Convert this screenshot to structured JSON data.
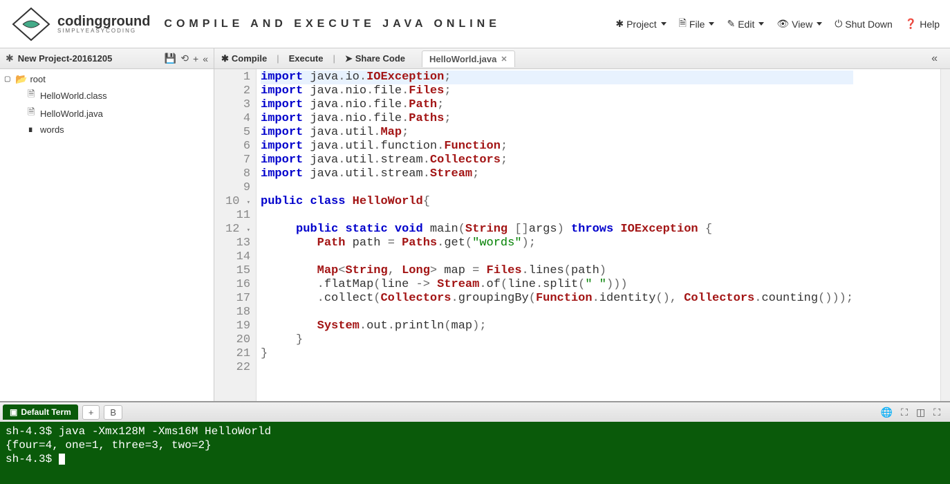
{
  "header": {
    "logo_main": "codingground",
    "logo_sub": "SIMPLYEASYCODING",
    "title": "COMPILE AND EXECUTE JAVA ONLINE",
    "menu": {
      "project": "Project",
      "file": "File",
      "edit": "Edit",
      "view": "View",
      "shutdown": "Shut Down",
      "help": "Help"
    }
  },
  "sidebar": {
    "project_name": "New Project-20161205",
    "tree": {
      "root": "root",
      "items": [
        "HelloWorld.class",
        "HelloWorld.java",
        "words"
      ]
    }
  },
  "editor_toolbar": {
    "compile": "Compile",
    "execute": "Execute",
    "share": "Share Code",
    "tab": "HelloWorld.java"
  },
  "code": {
    "lines": [
      {
        "n": 1,
        "t": [
          [
            "kw",
            "import"
          ],
          [
            "id",
            " java"
          ],
          [
            "punct",
            "."
          ],
          [
            "id",
            "io"
          ],
          [
            "punct",
            "."
          ],
          [
            "type",
            "IOException"
          ],
          [
            "punct",
            ";"
          ]
        ]
      },
      {
        "n": 2,
        "t": [
          [
            "kw",
            "import"
          ],
          [
            "id",
            " java"
          ],
          [
            "punct",
            "."
          ],
          [
            "id",
            "nio"
          ],
          [
            "punct",
            "."
          ],
          [
            "id",
            "file"
          ],
          [
            "punct",
            "."
          ],
          [
            "type",
            "Files"
          ],
          [
            "punct",
            ";"
          ]
        ]
      },
      {
        "n": 3,
        "t": [
          [
            "kw",
            "import"
          ],
          [
            "id",
            " java"
          ],
          [
            "punct",
            "."
          ],
          [
            "id",
            "nio"
          ],
          [
            "punct",
            "."
          ],
          [
            "id",
            "file"
          ],
          [
            "punct",
            "."
          ],
          [
            "type",
            "Path"
          ],
          [
            "punct",
            ";"
          ]
        ]
      },
      {
        "n": 4,
        "t": [
          [
            "kw",
            "import"
          ],
          [
            "id",
            " java"
          ],
          [
            "punct",
            "."
          ],
          [
            "id",
            "nio"
          ],
          [
            "punct",
            "."
          ],
          [
            "id",
            "file"
          ],
          [
            "punct",
            "."
          ],
          [
            "type",
            "Paths"
          ],
          [
            "punct",
            ";"
          ]
        ]
      },
      {
        "n": 5,
        "t": [
          [
            "kw",
            "import"
          ],
          [
            "id",
            " java"
          ],
          [
            "punct",
            "."
          ],
          [
            "id",
            "util"
          ],
          [
            "punct",
            "."
          ],
          [
            "type",
            "Map"
          ],
          [
            "punct",
            ";"
          ]
        ]
      },
      {
        "n": 6,
        "t": [
          [
            "kw",
            "import"
          ],
          [
            "id",
            " java"
          ],
          [
            "punct",
            "."
          ],
          [
            "id",
            "util"
          ],
          [
            "punct",
            "."
          ],
          [
            "id",
            "function"
          ],
          [
            "punct",
            "."
          ],
          [
            "type",
            "Function"
          ],
          [
            "punct",
            ";"
          ]
        ]
      },
      {
        "n": 7,
        "t": [
          [
            "kw",
            "import"
          ],
          [
            "id",
            " java"
          ],
          [
            "punct",
            "."
          ],
          [
            "id",
            "util"
          ],
          [
            "punct",
            "."
          ],
          [
            "id",
            "stream"
          ],
          [
            "punct",
            "."
          ],
          [
            "type",
            "Collectors"
          ],
          [
            "punct",
            ";"
          ]
        ]
      },
      {
        "n": 8,
        "t": [
          [
            "kw",
            "import"
          ],
          [
            "id",
            " java"
          ],
          [
            "punct",
            "."
          ],
          [
            "id",
            "util"
          ],
          [
            "punct",
            "."
          ],
          [
            "id",
            "stream"
          ],
          [
            "punct",
            "."
          ],
          [
            "type",
            "Stream"
          ],
          [
            "punct",
            ";"
          ]
        ]
      },
      {
        "n": 9,
        "t": []
      },
      {
        "n": 10,
        "fold": true,
        "t": [
          [
            "kw",
            "public"
          ],
          [
            "id",
            " "
          ],
          [
            "kw",
            "class"
          ],
          [
            "id",
            " "
          ],
          [
            "type",
            "HelloWorld"
          ],
          [
            "punct",
            "{"
          ]
        ]
      },
      {
        "n": 11,
        "t": []
      },
      {
        "n": 12,
        "fold": true,
        "t": [
          [
            "id",
            "     "
          ],
          [
            "kw",
            "public"
          ],
          [
            "id",
            " "
          ],
          [
            "kw",
            "static"
          ],
          [
            "id",
            " "
          ],
          [
            "kw",
            "void"
          ],
          [
            "id",
            " main"
          ],
          [
            "punct",
            "("
          ],
          [
            "type",
            "String"
          ],
          [
            "id",
            " "
          ],
          [
            "punct",
            "[]"
          ],
          [
            "id",
            "args"
          ],
          [
            "punct",
            ")"
          ],
          [
            "id",
            " "
          ],
          [
            "kw",
            "throws"
          ],
          [
            "id",
            " "
          ],
          [
            "type",
            "IOException"
          ],
          [
            "id",
            " "
          ],
          [
            "punct",
            "{"
          ]
        ]
      },
      {
        "n": 13,
        "t": [
          [
            "id",
            "        "
          ],
          [
            "type",
            "Path"
          ],
          [
            "id",
            " path "
          ],
          [
            "punct",
            "="
          ],
          [
            "id",
            " "
          ],
          [
            "type",
            "Paths"
          ],
          [
            "punct",
            "."
          ],
          [
            "id",
            "get"
          ],
          [
            "punct",
            "("
          ],
          [
            "str",
            "\"words\""
          ],
          [
            "punct",
            ")"
          ],
          [
            "punct",
            ";"
          ]
        ]
      },
      {
        "n": 14,
        "t": []
      },
      {
        "n": 15,
        "t": [
          [
            "id",
            "        "
          ],
          [
            "type",
            "Map"
          ],
          [
            "punct",
            "<"
          ],
          [
            "type",
            "String"
          ],
          [
            "punct",
            ","
          ],
          [
            "id",
            " "
          ],
          [
            "type",
            "Long"
          ],
          [
            "punct",
            ">"
          ],
          [
            "id",
            " map "
          ],
          [
            "punct",
            "="
          ],
          [
            "id",
            " "
          ],
          [
            "type",
            "Files"
          ],
          [
            "punct",
            "."
          ],
          [
            "id",
            "lines"
          ],
          [
            "punct",
            "("
          ],
          [
            "id",
            "path"
          ],
          [
            "punct",
            ")"
          ]
        ]
      },
      {
        "n": 16,
        "t": [
          [
            "id",
            "        "
          ],
          [
            "punct",
            "."
          ],
          [
            "id",
            "flatMap"
          ],
          [
            "punct",
            "("
          ],
          [
            "id",
            "line "
          ],
          [
            "punct",
            "->"
          ],
          [
            "id",
            " "
          ],
          [
            "type",
            "Stream"
          ],
          [
            "punct",
            "."
          ],
          [
            "id",
            "of"
          ],
          [
            "punct",
            "("
          ],
          [
            "id",
            "line"
          ],
          [
            "punct",
            "."
          ],
          [
            "id",
            "split"
          ],
          [
            "punct",
            "("
          ],
          [
            "str",
            "\" \""
          ],
          [
            "punct",
            ")))"
          ]
        ]
      },
      {
        "n": 17,
        "t": [
          [
            "id",
            "        "
          ],
          [
            "punct",
            "."
          ],
          [
            "id",
            "collect"
          ],
          [
            "punct",
            "("
          ],
          [
            "type",
            "Collectors"
          ],
          [
            "punct",
            "."
          ],
          [
            "id",
            "groupingBy"
          ],
          [
            "punct",
            "("
          ],
          [
            "type",
            "Function"
          ],
          [
            "punct",
            "."
          ],
          [
            "id",
            "identity"
          ],
          [
            "punct",
            "(),"
          ],
          [
            "id",
            " "
          ],
          [
            "type",
            "Collectors"
          ],
          [
            "punct",
            "."
          ],
          [
            "id",
            "counting"
          ],
          [
            "punct",
            "()));"
          ]
        ]
      },
      {
        "n": 18,
        "t": []
      },
      {
        "n": 19,
        "t": [
          [
            "id",
            "        "
          ],
          [
            "type",
            "System"
          ],
          [
            "punct",
            "."
          ],
          [
            "id",
            "out"
          ],
          [
            "punct",
            "."
          ],
          [
            "id",
            "println"
          ],
          [
            "punct",
            "("
          ],
          [
            "id",
            "map"
          ],
          [
            "punct",
            ")"
          ],
          [
            "punct",
            ";"
          ]
        ]
      },
      {
        "n": 20,
        "t": [
          [
            "id",
            "     "
          ],
          [
            "punct",
            "}"
          ]
        ]
      },
      {
        "n": 21,
        "t": [
          [
            "punct",
            "}"
          ]
        ]
      },
      {
        "n": 22,
        "t": []
      }
    ]
  },
  "terminal": {
    "tab_label": "Default Term",
    "btn_add": "+",
    "btn_b": "B",
    "lines": [
      "sh-4.3$ java -Xmx128M -Xms16M HelloWorld",
      "{four=4, one=1, three=3, two=2}",
      "sh-4.3$ "
    ]
  }
}
